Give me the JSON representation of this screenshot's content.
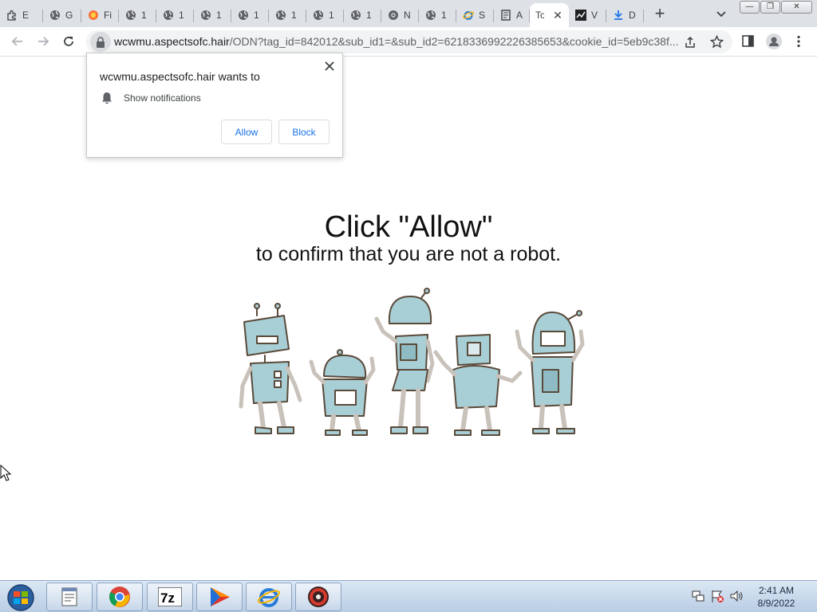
{
  "browser": {
    "tabs": [
      {
        "title": "E",
        "icon": "extension-icon"
      },
      {
        "title": "G",
        "icon": "globe-icon"
      },
      {
        "title": "Fi",
        "icon": "firefox-icon"
      },
      {
        "title": "1",
        "icon": "globe-icon"
      },
      {
        "title": "1",
        "icon": "globe-icon"
      },
      {
        "title": "1",
        "icon": "globe-icon"
      },
      {
        "title": "1",
        "icon": "globe-icon"
      },
      {
        "title": "1",
        "icon": "globe-icon"
      },
      {
        "title": "1",
        "icon": "globe-icon"
      },
      {
        "title": "1",
        "icon": "globe-icon"
      },
      {
        "title": "N",
        "icon": "chrome-icon"
      },
      {
        "title": "1",
        "icon": "globe-icon"
      },
      {
        "title": "S",
        "icon": "ie-icon"
      },
      {
        "title": "A",
        "icon": "document-icon"
      },
      {
        "title": "To",
        "icon": "none",
        "active": true
      },
      {
        "title": "V",
        "icon": "stock-icon"
      },
      {
        "title": "D",
        "icon": "download-icon"
      }
    ],
    "url_host": "wcwmu.aspectsofc.hair",
    "url_path": "/ODN?tag_id=842012&sub_id1=&sub_id2=6218336992226385653&cookie_id=5eb9c38f..."
  },
  "popup": {
    "title": "wcwmu.aspectsofc.hair wants to",
    "permission": "Show notifications",
    "allow_label": "Allow",
    "block_label": "Block"
  },
  "page": {
    "headline": "Click \"Allow\"",
    "subline": "to confirm that you are not a robot.",
    "illustration": "five-cartoon-robots"
  },
  "taskbar": {
    "apps": [
      "notepad-icon",
      "chrome-icon",
      "7zip-icon",
      "media-player-icon",
      "ie-icon",
      "ccleaner-icon"
    ],
    "time": "2:41 AM",
    "date": "8/9/2022"
  },
  "colors": {
    "accent_blue": "#1a73e8",
    "robot_body": "#a8cfd6",
    "robot_outline": "#5a4a3a"
  }
}
